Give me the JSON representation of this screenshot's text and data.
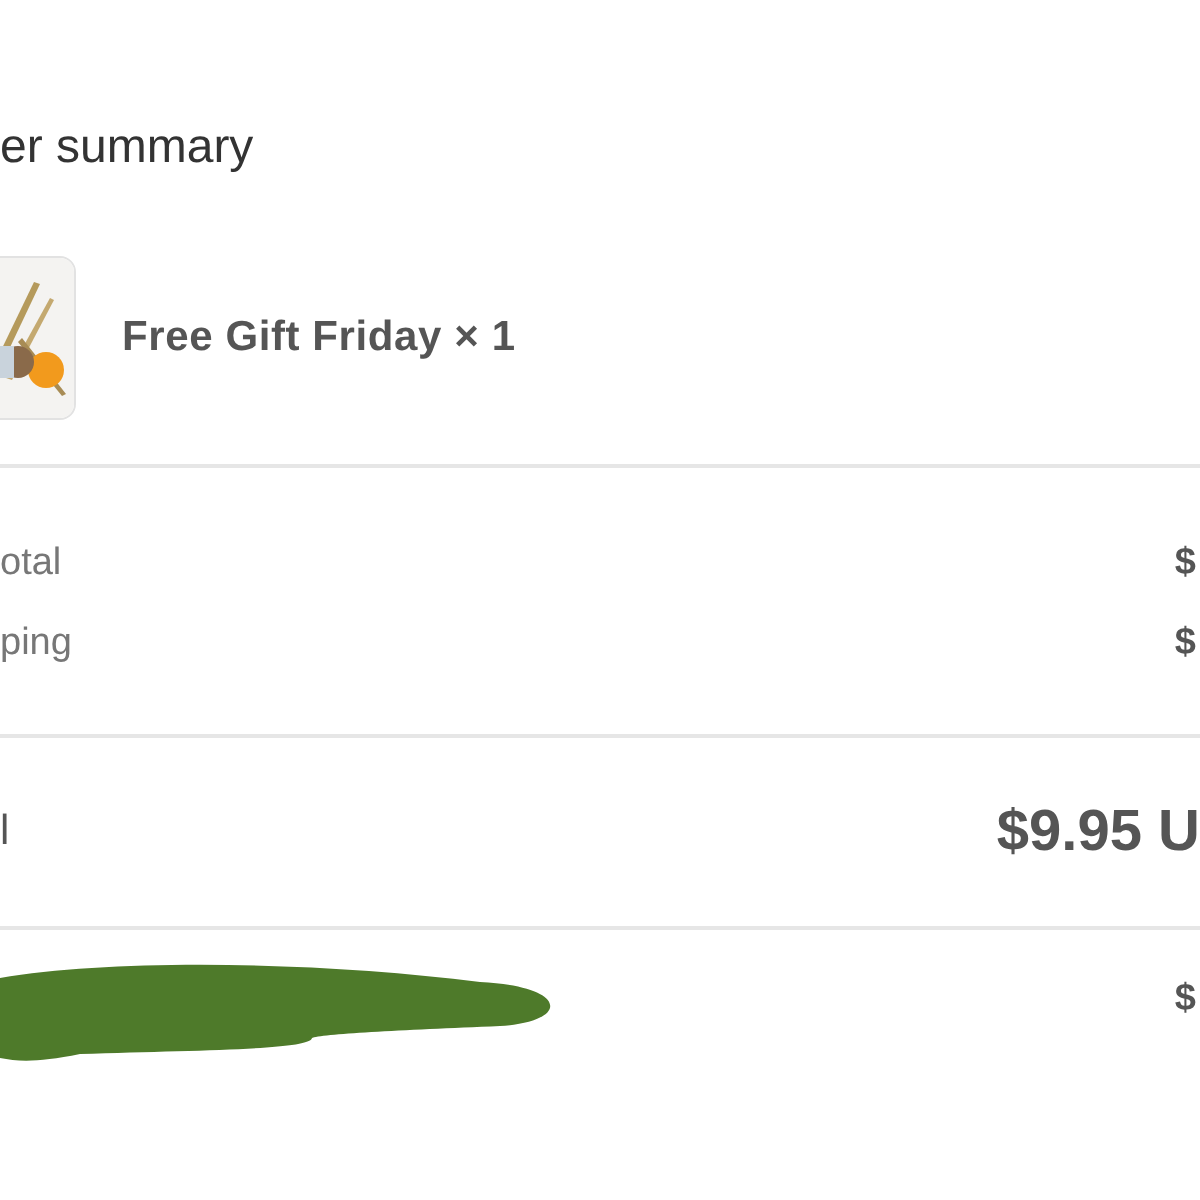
{
  "heading": "er summary",
  "item": {
    "kind": "picture",
    "label": "Free Gift Friday × 1"
  },
  "costs": [
    {
      "label": "otal",
      "value": "$"
    },
    {
      "label": "ping",
      "value": "$"
    }
  ],
  "total": {
    "label": "l",
    "value": "$9.95 U"
  },
  "extra_row": {
    "value": "$"
  }
}
